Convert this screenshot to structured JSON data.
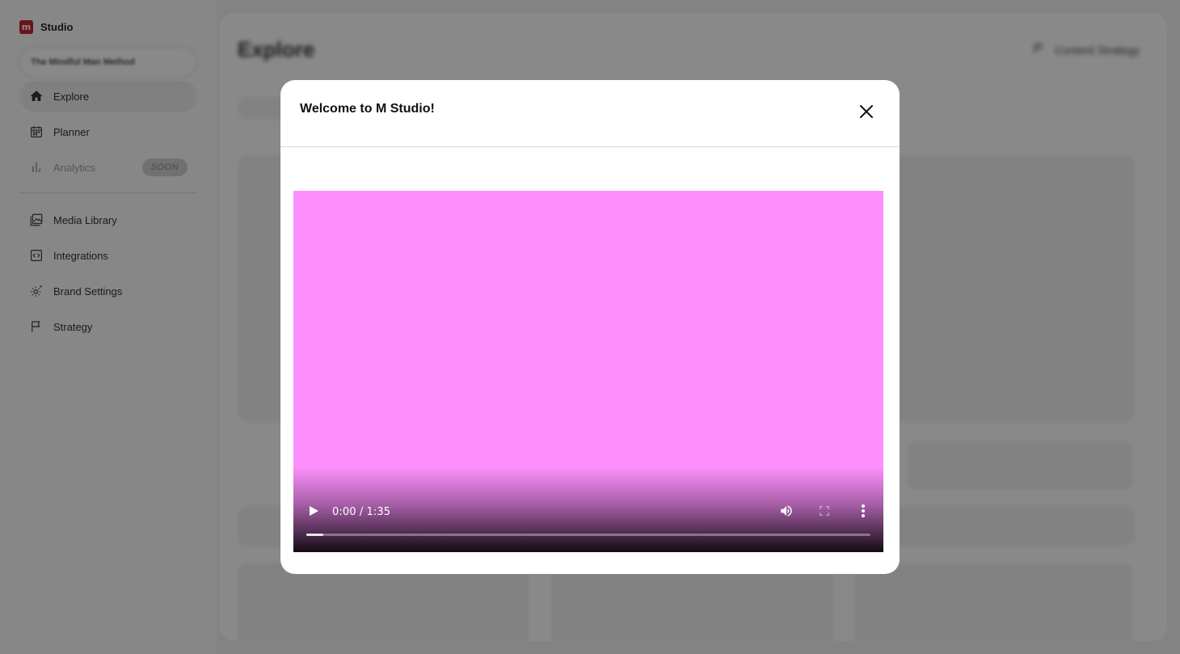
{
  "app": {
    "brand_letter": "m",
    "brand_name": "Studio",
    "brand_color": "#c01222"
  },
  "sidebar": {
    "account_selector_text": "The Mindful Man Method",
    "primary_items": [
      {
        "label": "Explore",
        "icon": "home-icon",
        "active": true
      },
      {
        "label": "Planner",
        "icon": "calendar-icon"
      },
      {
        "label": "Analytics",
        "icon": "bar-chart-icon",
        "disabled": true,
        "badge": "SOON"
      }
    ],
    "secondary_items": [
      {
        "label": "Media Library",
        "icon": "image-library-icon"
      },
      {
        "label": "Integrations",
        "icon": "code-integration-icon"
      },
      {
        "label": "Brand Settings",
        "icon": "settings-gear-icon"
      },
      {
        "label": "Strategy",
        "icon": "flag-icon"
      }
    ]
  },
  "background_page": {
    "title": "Explore",
    "strategy_button_label": "Content Strategy"
  },
  "modal": {
    "title": "Welcome to M Studio!",
    "close_icon": "close-icon",
    "video": {
      "background_color": "#fc8ffc",
      "time_current": "0:00",
      "time_total": "1:35",
      "time_display": "0:00 / 1:35",
      "buffered_fraction": 0.03,
      "controls": [
        "play-icon",
        "volume-icon",
        "fullscreen-icon",
        "more-vertical-icon"
      ]
    }
  }
}
